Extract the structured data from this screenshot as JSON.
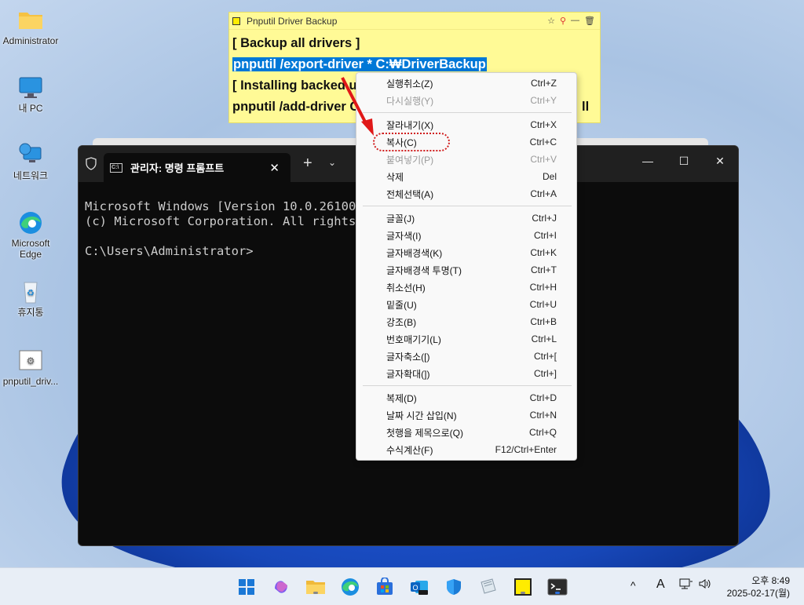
{
  "desktop": {
    "icons": [
      {
        "label": "Administrator",
        "icon": "folder-icon"
      },
      {
        "label": "내 PC",
        "icon": "monitor-icon"
      },
      {
        "label": "네트워크",
        "icon": "network-icon"
      },
      {
        "label": "Microsoft Edge",
        "icon": "edge-icon"
      },
      {
        "label": "휴지통",
        "icon": "recycle-bin-icon"
      },
      {
        "label": "pnputil_driv...",
        "icon": "settings-file-icon"
      }
    ]
  },
  "sticky": {
    "title": "Pnputil Driver Backup",
    "lines": [
      "[ Backup all drivers ]",
      "pnputil /export-driver * C:₩DriverBackup",
      "[ Installing backed u",
      "pnputil /add-driver C"
    ],
    "trailing_fragment": "ll"
  },
  "terminal": {
    "tab_title": "관리자: 명령 프롬프트",
    "lines": [
      "Microsoft Windows [Version 10.0.26100.3",
      "(c) Microsoft Corporation. All rights r",
      "",
      "C:\\Users\\Administrator>"
    ]
  },
  "context_menu": {
    "groups": [
      [
        {
          "label": "실행취소(Z)",
          "shortcut": "Ctrl+Z",
          "enabled": true
        },
        {
          "label": "다시실행(Y)",
          "shortcut": "Ctrl+Y",
          "enabled": false
        }
      ],
      [
        {
          "label": "잘라내기(X)",
          "shortcut": "Ctrl+X",
          "enabled": true
        },
        {
          "label": "복사(C)",
          "shortcut": "Ctrl+C",
          "enabled": true
        },
        {
          "label": "붙여넣기(P)",
          "shortcut": "Ctrl+V",
          "enabled": false
        },
        {
          "label": "삭제",
          "shortcut": "Del",
          "enabled": true
        },
        {
          "label": "전체선택(A)",
          "shortcut": "Ctrl+A",
          "enabled": true
        }
      ],
      [
        {
          "label": "글꼴(J)",
          "shortcut": "Ctrl+J",
          "enabled": true
        },
        {
          "label": "글자색(I)",
          "shortcut": "Ctrl+I",
          "enabled": true
        },
        {
          "label": "글자배경색(K)",
          "shortcut": "Ctrl+K",
          "enabled": true
        },
        {
          "label": "글자배경색 투명(T)",
          "shortcut": "Ctrl+T",
          "enabled": true
        },
        {
          "label": "취소선(H)",
          "shortcut": "Ctrl+H",
          "enabled": true
        },
        {
          "label": "밑줄(U)",
          "shortcut": "Ctrl+U",
          "enabled": true
        },
        {
          "label": "강조(B)",
          "shortcut": "Ctrl+B",
          "enabled": true
        },
        {
          "label": "번호매기기(L)",
          "shortcut": "Ctrl+L",
          "enabled": true
        },
        {
          "label": "글자축소([)",
          "shortcut": "Ctrl+[",
          "enabled": true
        },
        {
          "label": "글자확대(])",
          "shortcut": "Ctrl+]",
          "enabled": true
        }
      ],
      [
        {
          "label": "복제(D)",
          "shortcut": "Ctrl+D",
          "enabled": true
        },
        {
          "label": "날짜 시간 삽입(N)",
          "shortcut": "Ctrl+N",
          "enabled": true
        },
        {
          "label": "첫행을 제목으로(Q)",
          "shortcut": "Ctrl+Q",
          "enabled": true
        },
        {
          "label": "수식계산(F)",
          "shortcut": "F12/Ctrl+Enter",
          "enabled": true
        }
      ]
    ]
  },
  "taskbar": {
    "apps": [
      "start-icon",
      "copilot-icon",
      "file-explorer-icon",
      "edge-icon",
      "store-icon",
      "outlook-icon",
      "defender-icon",
      "notes-icon",
      "sticky-notes-icon",
      "terminal-icon"
    ],
    "tray": {
      "chevron": "^",
      "ime": "A"
    },
    "clock": {
      "time": "오후 8:49",
      "date": "2025-02-17(월)"
    }
  }
}
